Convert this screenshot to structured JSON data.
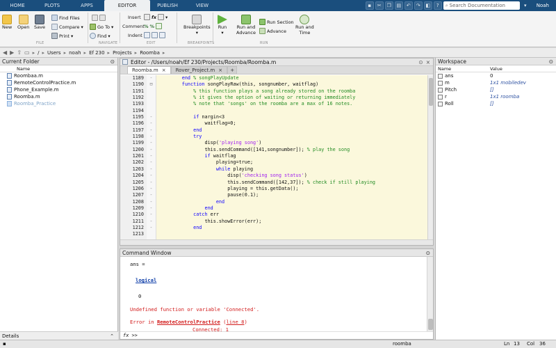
{
  "toolstrip": {
    "tabs": [
      "HOME",
      "PLOTS",
      "APPS",
      "EDITOR",
      "PUBLISH",
      "VIEW"
    ],
    "active_tab": "EDITOR",
    "search_placeholder": "Search Documentation",
    "user": "Noah"
  },
  "ribbon": {
    "file": {
      "new": "New",
      "open": "Open",
      "save": "Save",
      "find_files": "Find Files",
      "compare": "Compare",
      "print": "Print",
      "section": "FILE"
    },
    "navigate": {
      "goto": "Go To",
      "find": "Find",
      "section": "NAVIGATE"
    },
    "edit": {
      "insert": "Insert",
      "comment": "Comment",
      "indent": "Indent",
      "section": "EDIT"
    },
    "breakpoints": {
      "label": "Breakpoints",
      "section": "BREAKPOINTS"
    },
    "run": {
      "run": "Run",
      "run_and_advance_1": "Run and",
      "run_and_advance_2": "Advance",
      "run_section": "Run Section",
      "advance": "Advance",
      "run_and_time_1": "Run and",
      "run_and_time_2": "Time",
      "section": "RUN"
    }
  },
  "address": {
    "crumbs": [
      "/",
      "Users",
      "noah",
      "Ef 230",
      "Projects",
      "Roomba"
    ]
  },
  "current_folder": {
    "title": "Current Folder",
    "column": "Name",
    "files": [
      {
        "name": "Roombaa.m",
        "kind": "file"
      },
      {
        "name": "RemoteControlPractice.m",
        "kind": "file"
      },
      {
        "name": "Phone_Example.m",
        "kind": "file"
      },
      {
        "name": "Roomba.m",
        "kind": "file"
      },
      {
        "name": "Roomba_Practice",
        "kind": "folder"
      }
    ],
    "details_label": "Details"
  },
  "editor": {
    "title": "Editor - /Users/noah/Ef 230/Projects/Roomba/Roomba.m",
    "tabs": [
      "Roomba.m",
      "Rover_Project.m"
    ],
    "line_numbers": [
      "1189",
      "1190",
      "1191",
      "1192",
      "1193",
      "1194",
      "1195",
      "1196",
      "1197",
      "1198",
      "1199",
      "1200",
      "1201",
      "1202",
      "1203",
      "1204",
      "1205",
      "1206",
      "1207",
      "1208",
      "1209",
      "1210",
      "1211",
      "1212",
      "1213"
    ],
    "markers": [
      "-",
      "⊟",
      "",
      "",
      "",
      "",
      "-",
      "-",
      "-",
      "-",
      "-",
      "-",
      "-",
      "-",
      "-",
      "-",
      "-",
      "-",
      "-",
      "-",
      "-",
      "-",
      "-",
      "-",
      ""
    ],
    "lines": [
      [
        {
          "t": "        "
        },
        {
          "t": "end",
          "c": "kw"
        },
        {
          "t": " "
        },
        {
          "t": "% songPlayUpdate",
          "c": "cm"
        }
      ],
      [
        {
          "t": "        "
        },
        {
          "t": "function",
          "c": "kw"
        },
        {
          "t": " songPlayRaw(this, songnumber, waitflag)"
        }
      ],
      [
        {
          "t": "            "
        },
        {
          "t": "% this function plays a song already stored on the roomba",
          "c": "cm"
        }
      ],
      [
        {
          "t": "            "
        },
        {
          "t": "% it gives the option of waiting or returning immediately",
          "c": "cm"
        }
      ],
      [
        {
          "t": "            "
        },
        {
          "t": "% note that 'songs' on the roomba are a max of 16 notes.",
          "c": "cm"
        }
      ],
      [
        {
          "t": ""
        }
      ],
      [
        {
          "t": "            "
        },
        {
          "t": "if",
          "c": "kw"
        },
        {
          "t": " nargin<3"
        }
      ],
      [
        {
          "t": "                waitflag=0;"
        }
      ],
      [
        {
          "t": "            "
        },
        {
          "t": "end",
          "c": "kw"
        }
      ],
      [
        {
          "t": "            "
        },
        {
          "t": "try",
          "c": "kw"
        }
      ],
      [
        {
          "t": "                disp("
        },
        {
          "t": "'playing song'",
          "c": "st"
        },
        {
          "t": ")"
        }
      ],
      [
        {
          "t": "                this.sendCommand([141,songnumber]); "
        },
        {
          "t": "% play the song",
          "c": "cm"
        }
      ],
      [
        {
          "t": "                "
        },
        {
          "t": "if",
          "c": "kw"
        },
        {
          "t": " waitflag"
        }
      ],
      [
        {
          "t": "                    playing=true;"
        }
      ],
      [
        {
          "t": "                    "
        },
        {
          "t": "while",
          "c": "kw"
        },
        {
          "t": " playing"
        }
      ],
      [
        {
          "t": "                        disp("
        },
        {
          "t": "'checking song status'",
          "c": "st"
        },
        {
          "t": ")"
        }
      ],
      [
        {
          "t": "                        this.sendCommand([142,37]); "
        },
        {
          "t": "% check if still playing",
          "c": "cm"
        }
      ],
      [
        {
          "t": "                        playing = this.getData();"
        }
      ],
      [
        {
          "t": "                        pause(0.1);"
        }
      ],
      [
        {
          "t": "                    "
        },
        {
          "t": "end",
          "c": "kw"
        }
      ],
      [
        {
          "t": "                "
        },
        {
          "t": "end",
          "c": "kw"
        }
      ],
      [
        {
          "t": "            "
        },
        {
          "t": "catch",
          "c": "kw"
        },
        {
          "t": " err"
        }
      ],
      [
        {
          "t": "                this.showError(err);"
        }
      ],
      [
        {
          "t": "            "
        },
        {
          "t": "end",
          "c": "kw"
        }
      ],
      [
        {
          "t": ""
        }
      ]
    ]
  },
  "command_window": {
    "title": "Command Window",
    "ans_line": "ans =",
    "logical_word": "logical",
    "value": "0",
    "undefined_error": "Undefined function or variable 'Connected'.",
    "error_in": "Error in ",
    "error_file": "RemoteControlPractice",
    "error_line_link": "line 8",
    "error_code": "Connected: 1",
    "prompt": ">>",
    "fx": "fx"
  },
  "workspace": {
    "title": "Workspace",
    "col_name": "Name",
    "col_value": "Value",
    "vars": [
      {
        "name": "ans",
        "value": "0",
        "plain": true
      },
      {
        "name": "m",
        "value": "1x1 mobiledev",
        "plain": false
      },
      {
        "name": "Pitch",
        "value": "[]",
        "plain": false
      },
      {
        "name": "r",
        "value": "1x1 roomba",
        "plain": false
      },
      {
        "name": "Roll",
        "value": "[]",
        "plain": false
      }
    ]
  },
  "status": {
    "file": "roomba",
    "ln_label": "Ln",
    "ln": "13",
    "col_label": "Col",
    "col": "36"
  },
  "colors": {
    "toolstrip": "#1a4e7d",
    "code_bg": "#fbf8dc",
    "keyword": "#0e00ff",
    "comment": "#228b22",
    "string": "#a020f0",
    "error": "#d21a1a"
  }
}
